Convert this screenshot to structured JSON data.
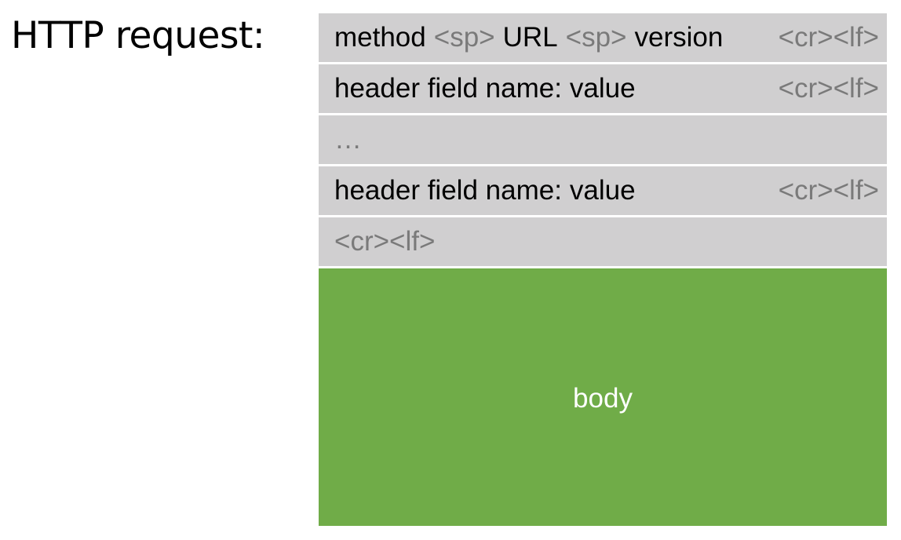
{
  "title": "HTTP request:",
  "rows": [
    {
      "parts": [
        {
          "text": "method",
          "style": "dark"
        },
        {
          "text": "<sp>",
          "style": "gray"
        },
        {
          "text": "URL",
          "style": "dark"
        },
        {
          "text": "<sp>",
          "style": "gray"
        },
        {
          "text": "version",
          "style": "dark"
        }
      ],
      "terminator": "<cr><lf>"
    },
    {
      "parts": [
        {
          "text": "header field name:",
          "style": "dark"
        },
        {
          "text": "value",
          "style": "dark"
        }
      ],
      "terminator": "<cr><lf>"
    },
    {
      "parts": [
        {
          "text": "…",
          "style": "gray"
        }
      ],
      "terminator": ""
    },
    {
      "parts": [
        {
          "text": "header field name:",
          "style": "dark"
        },
        {
          "text": "value",
          "style": "dark"
        }
      ],
      "terminator": "<cr><lf>"
    },
    {
      "parts": [
        {
          "text": "<cr><lf>",
          "style": "gray"
        }
      ],
      "terminator": ""
    }
  ],
  "body_label": "body",
  "colors": {
    "row_fill": "#d0cfd0",
    "body_fill": "#70ac48",
    "text_dark": "#000000",
    "text_gray": "#7a7a7a",
    "body_text": "#ffffff"
  }
}
